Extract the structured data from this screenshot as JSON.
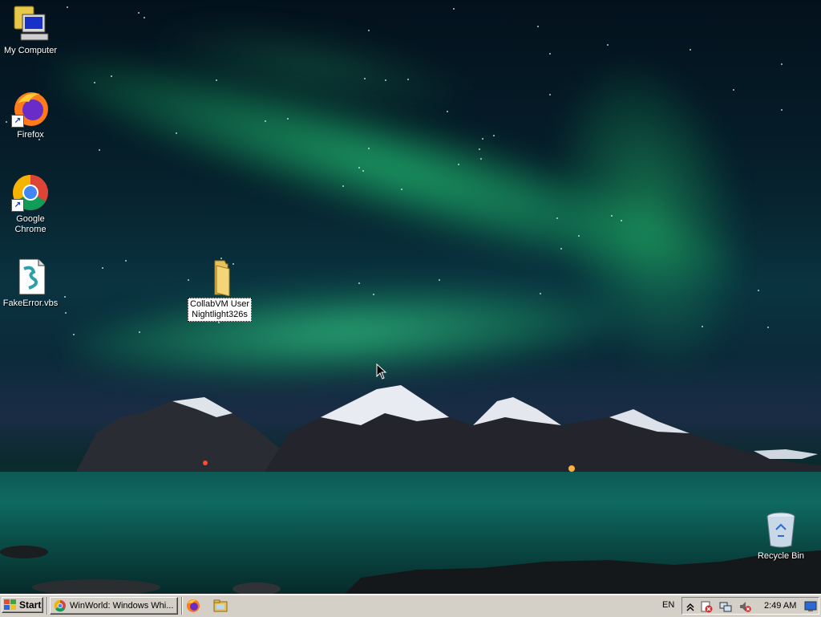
{
  "desktop": {
    "icons": [
      {
        "label": "My Computer"
      },
      {
        "label": "Firefox"
      },
      {
        "label": "Google Chrome"
      },
      {
        "label": "FakeError.vbs"
      },
      {
        "label_line1": "CollabVM User",
        "label_line2": "Nightlight326s"
      },
      {
        "label": "Recycle Bin"
      }
    ]
  },
  "taskbar": {
    "start_label": "Start",
    "tasks": [
      {
        "label": "WinWorld: Windows Whi...",
        "icon": "chrome-icon"
      }
    ],
    "quick_launch": [
      "firefox-icon",
      "explorer-icon"
    ],
    "language": "EN",
    "clock": "2:49 AM",
    "tray_icons": [
      "show-hidden-icons-chevron",
      "security-alert-icon",
      "network-icon",
      "volume-muted-icon",
      "desktop-icon"
    ]
  },
  "colors": {
    "taskbar_bg": "#d4d0c8",
    "aurora": "#2ee08a",
    "sky": "#03111c"
  }
}
